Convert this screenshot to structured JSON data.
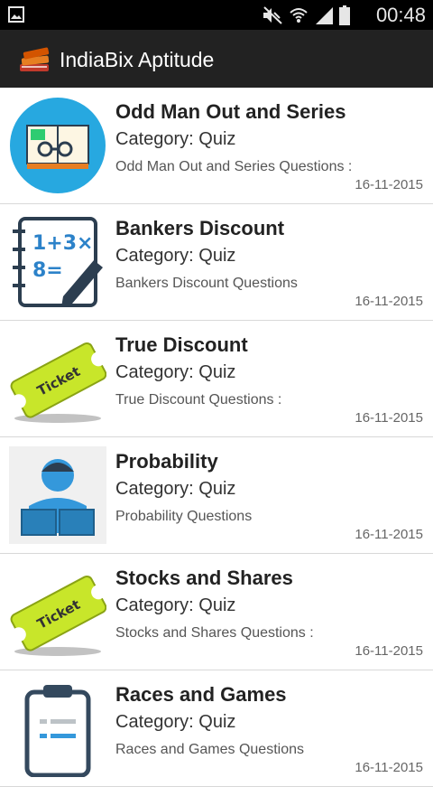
{
  "status_bar": {
    "time": "00:48",
    "icons": [
      "gallery-icon",
      "mute-icon",
      "wifi-icon",
      "signal-icon",
      "battery-icon"
    ]
  },
  "action_bar": {
    "title": "IndiaBix Aptitude",
    "icon": "books-icon"
  },
  "items": [
    {
      "title": "Odd Man Out and Series",
      "category": "Category: Quiz",
      "description": "Odd Man Out and Series Questions :",
      "date": "16-11-2015",
      "thumb": "book-glasses-icon"
    },
    {
      "title": "Bankers Discount",
      "category": "Category: Quiz",
      "description": "Bankers Discount Questions",
      "date": "16-11-2015",
      "thumb": "math-notebook-icon"
    },
    {
      "title": "True Discount",
      "category": "Category: Quiz",
      "description": "True Discount Questions :",
      "date": "16-11-2015",
      "thumb": "ticket-icon"
    },
    {
      "title": "Probability",
      "category": "Category: Quiz",
      "description": "Probability Questions",
      "date": "16-11-2015",
      "thumb": "reader-icon"
    },
    {
      "title": "Stocks and Shares",
      "category": "Category: Quiz",
      "description": "Stocks and Shares Questions :",
      "date": "16-11-2015",
      "thumb": "ticket-icon"
    },
    {
      "title": "Races and Games",
      "category": "Category: Quiz",
      "description": "Races and Games Questions",
      "date": "16-11-2015",
      "thumb": "clipboard-icon"
    }
  ]
}
